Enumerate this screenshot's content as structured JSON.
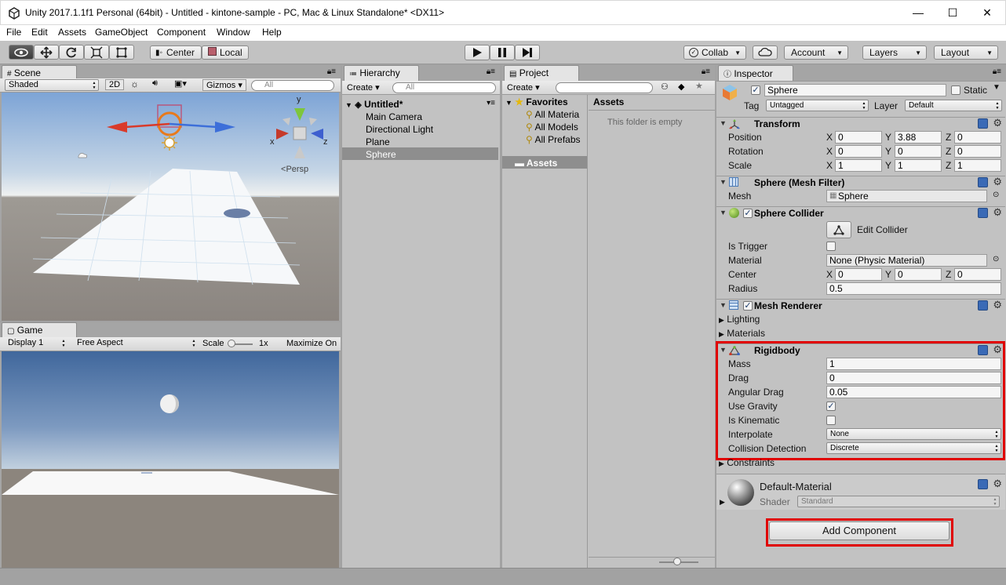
{
  "window": {
    "title": "Unity 2017.1.1f1 Personal (64bit) - Untitled - kintone-sample - PC, Mac & Linux Standalone* <DX11>",
    "controls": {
      "minimize": "—",
      "maximize": "☐",
      "close": "✕"
    }
  },
  "menu": [
    "File",
    "Edit",
    "Assets",
    "GameObject",
    "Component",
    "Window",
    "Help"
  ],
  "toolbar": {
    "pivot": "Center",
    "space": "Local",
    "collab": "Collab",
    "account": "Account",
    "layers": "Layers",
    "layout": "Layout"
  },
  "scene": {
    "tab": "Scene",
    "shading": "Shaded",
    "mode2d": "2D",
    "gizmos": "Gizmos",
    "search_placeholder": "All",
    "persp": "Persp",
    "gizmo_axes": {
      "x": "x",
      "y": "y",
      "z": "z"
    }
  },
  "game": {
    "tab": "Game",
    "display": "Display 1",
    "aspect": "Free Aspect",
    "scale_label": "Scale",
    "scale_value": "1x",
    "maximize": "Maximize On"
  },
  "hierarchy": {
    "tab": "Hierarchy",
    "create": "Create",
    "search_placeholder": "All",
    "scene_name": "Untitled*",
    "items": [
      "Main Camera",
      "Directional Light",
      "Plane",
      "Sphere"
    ],
    "selected": "Sphere"
  },
  "project": {
    "tab": "Project",
    "create": "Create",
    "favorites": "Favorites",
    "favorite_items": [
      "All Materia",
      "All Models",
      "All Prefabs"
    ],
    "assets_folder": "Assets",
    "assets_header": "Assets",
    "empty_text": "This folder is empty"
  },
  "inspector": {
    "tab": "Inspector",
    "object_name": "Sphere",
    "static_label": "Static",
    "tag_label": "Tag",
    "tag_value": "Untagged",
    "layer_label": "Layer",
    "layer_value": "Default",
    "transform": {
      "title": "Transform",
      "position_label": "Position",
      "position": {
        "x": "0",
        "y": "3.88",
        "z": "0"
      },
      "rotation_label": "Rotation",
      "rotation": {
        "x": "0",
        "y": "0",
        "z": "0"
      },
      "scale_label": "Scale",
      "scale": {
        "x": "1",
        "y": "1",
        "z": "1"
      }
    },
    "mesh_filter": {
      "title": "Sphere (Mesh Filter)",
      "mesh_label": "Mesh",
      "mesh_value": "Sphere"
    },
    "sphere_collider": {
      "title": "Sphere Collider",
      "edit_collider": "Edit Collider",
      "is_trigger_label": "Is Trigger",
      "material_label": "Material",
      "material_value": "None (Physic Material)",
      "center_label": "Center",
      "center": {
        "x": "0",
        "y": "0",
        "z": "0"
      },
      "radius_label": "Radius",
      "radius_value": "0.5"
    },
    "mesh_renderer": {
      "title": "Mesh Renderer",
      "lighting": "Lighting",
      "materials": "Materials"
    },
    "rigidbody": {
      "title": "Rigidbody",
      "mass_label": "Mass",
      "mass": "1",
      "drag_label": "Drag",
      "drag": "0",
      "angular_drag_label": "Angular Drag",
      "angular_drag": "0.05",
      "use_gravity_label": "Use Gravity",
      "is_kinematic_label": "Is Kinematic",
      "interpolate_label": "Interpolate",
      "interpolate": "None",
      "collision_label": "Collision Detection",
      "collision": "Discrete",
      "constraints": "Constraints"
    },
    "material": {
      "name": "Default-Material",
      "shader_label": "Shader",
      "shader_value": "Standard"
    },
    "add_component": "Add Component"
  },
  "axis_labels": {
    "x": "X",
    "y": "Y",
    "z": "Z"
  }
}
